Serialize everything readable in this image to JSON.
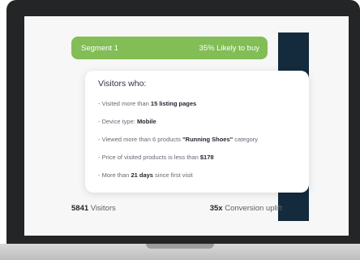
{
  "segment": {
    "name": "Segment 1",
    "likelihood": "35% Likely to buy",
    "accent_color": "#82bd56"
  },
  "card": {
    "title": "Visitors who:",
    "criteria": [
      {
        "prefix": "- Visited more than ",
        "strong": "15 listing pages",
        "suffix": ""
      },
      {
        "prefix": "- Device type: ",
        "strong": "Mobile",
        "suffix": ""
      },
      {
        "prefix": "- Viewed more than 6 products ",
        "strong": "\"Running Shoes\"",
        "suffix": " category"
      },
      {
        "prefix": "- Price of visited products is less than ",
        "strong": "$178",
        "suffix": ""
      },
      {
        "prefix": "- More than ",
        "strong": "21 days",
        "suffix": " since first visit"
      }
    ]
  },
  "stats": {
    "visitors_value": "5841",
    "visitors_label": " Visitors",
    "uplift_value": "35x",
    "uplift_label": " Conversion uplift"
  },
  "colors": {
    "navy_panel": "#142a3d",
    "laptop_bezel": "#232526"
  }
}
